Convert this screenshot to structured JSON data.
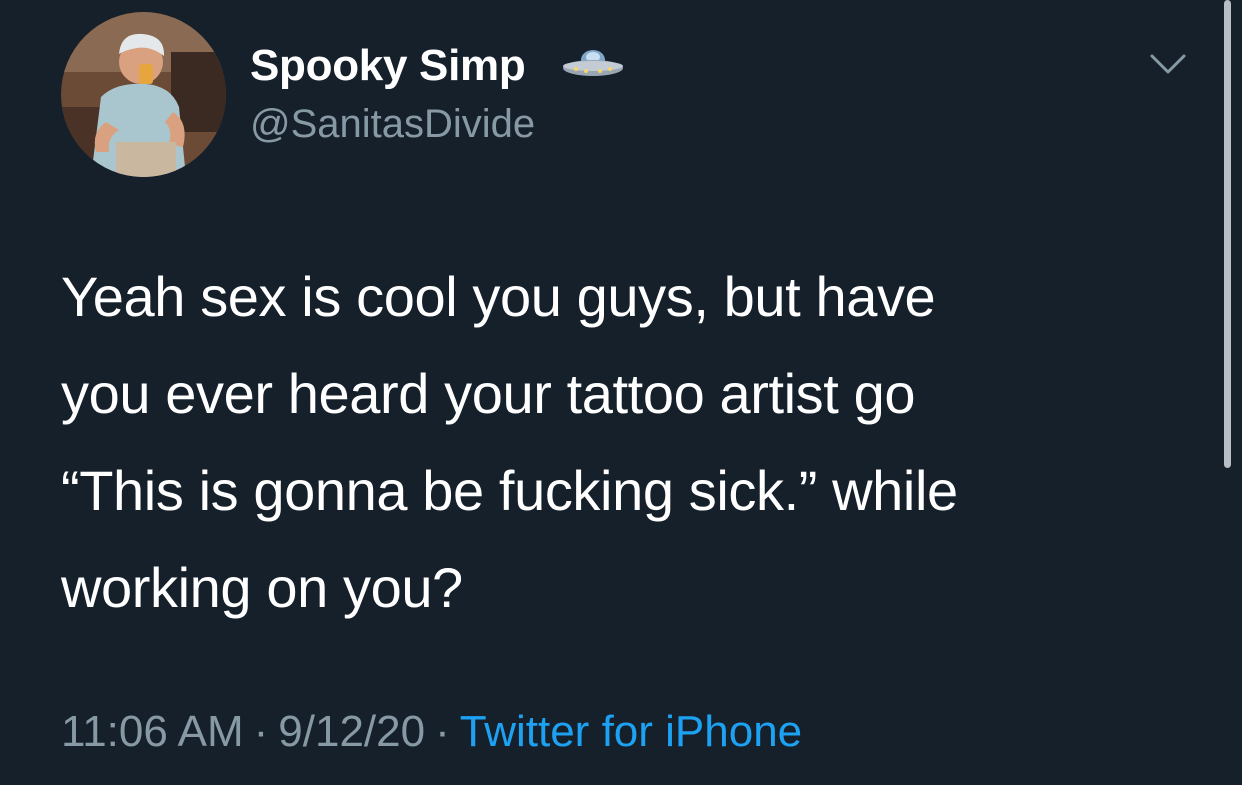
{
  "author": {
    "display_name": "Spooky Simp",
    "handle": "@SanitasDivide",
    "name_emoji_icon": "ufo-icon",
    "avatar_icon": "profile-photo"
  },
  "tweet": {
    "text_lines": [
      "Yeah sex is cool you guys, but have",
      "you ever heard your tattoo artist go",
      "“This is gonna be fucking sick.” while",
      "working on you?"
    ],
    "time": "11:06 AM",
    "date": "9/12/20",
    "separator": "·",
    "source": "Twitter for iPhone"
  },
  "controls": {
    "more_icon": "chevron-down-icon"
  },
  "colors": {
    "background": "#15202b",
    "text": "#ffffff",
    "secondary_text": "#8899a6",
    "link": "#1da1f2",
    "scrollbar": "#b9bec4"
  }
}
